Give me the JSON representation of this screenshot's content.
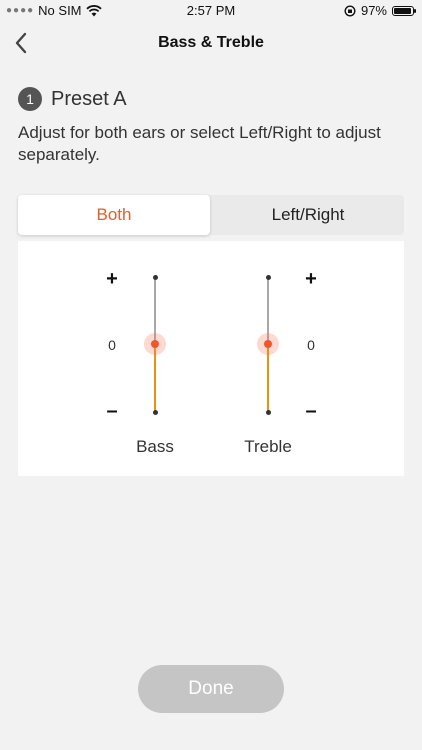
{
  "status_bar": {
    "carrier": "No SIM",
    "time": "2:57 PM",
    "battery": "97%",
    "battery_level": 0.97
  },
  "nav": {
    "title": "Bass & Treble"
  },
  "preset": {
    "number": "1",
    "label": "Preset A"
  },
  "description": "Adjust for both ears or select Left/Right to adjust separately.",
  "tabs": [
    {
      "label": "Both",
      "active": true
    },
    {
      "label": "Left/Right",
      "active": false
    }
  ],
  "sliders": [
    {
      "label": "Bass",
      "value_label": "0",
      "plus": "+",
      "minus": "–",
      "value": 0
    },
    {
      "label": "Treble",
      "value_label": "0",
      "plus": "+",
      "minus": "–",
      "value": 0
    }
  ],
  "done_button": {
    "label": "Done",
    "enabled": false
  },
  "colors": {
    "accent": "#e2602b",
    "track_fill": "#e9930f",
    "knob": "#f0562e",
    "done_disabled": "#c5c5c5"
  }
}
